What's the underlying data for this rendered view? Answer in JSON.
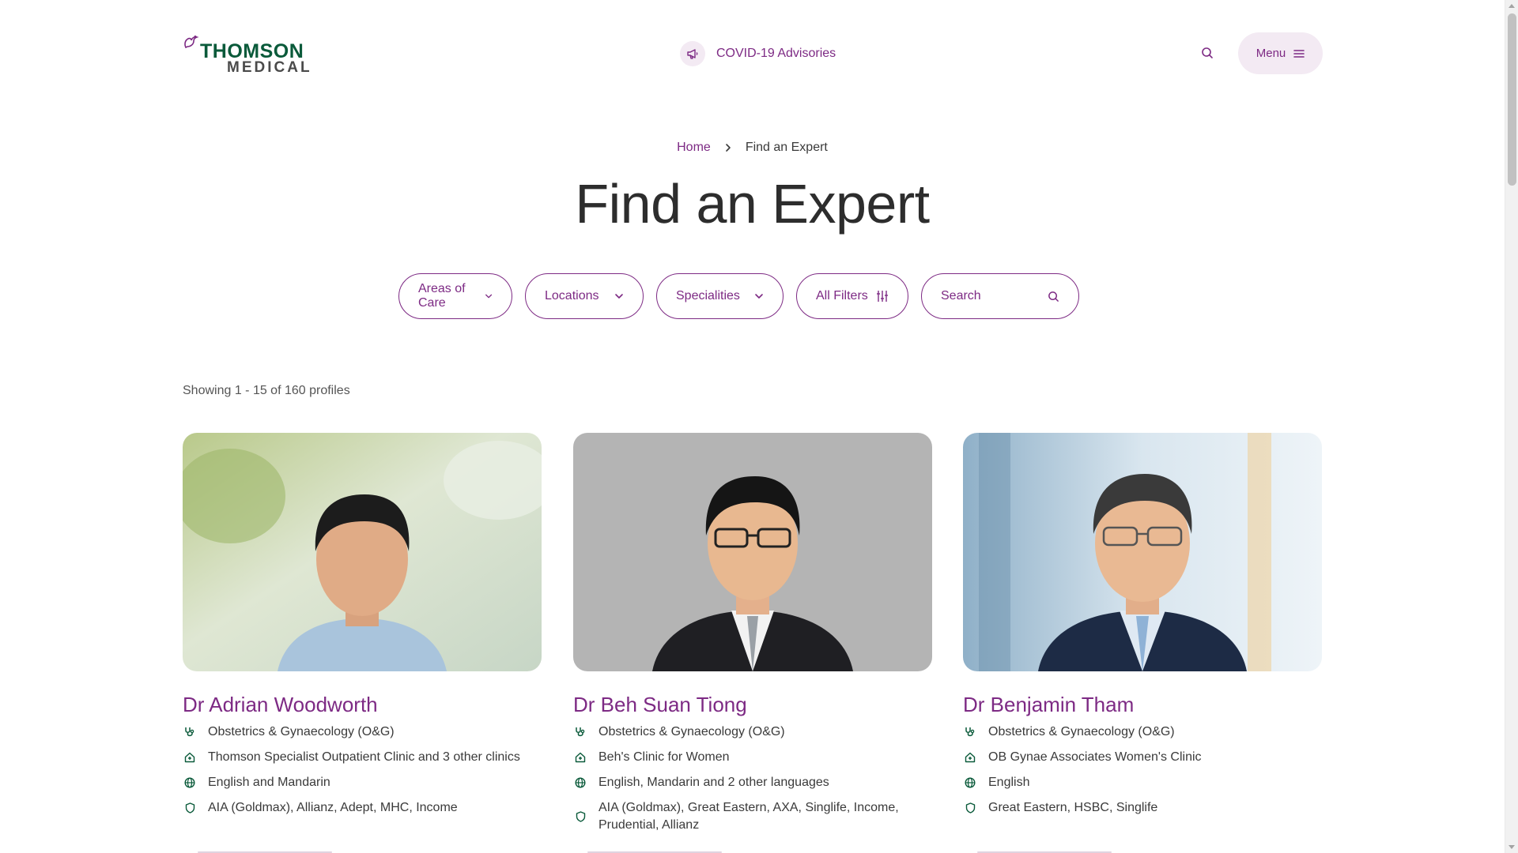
{
  "header": {
    "logo_line1": "THOMSON",
    "logo_line2": "MEDICAL",
    "advisory_label": "COVID-19 Advisories",
    "menu_label": "Menu"
  },
  "breadcrumb": {
    "home": "Home",
    "current": "Find an Expert"
  },
  "page_title": "Find an Expert",
  "filters": {
    "areas": "Areas of Care",
    "locations": "Locations",
    "specialities": "Specialities",
    "all_filters": "All Filters",
    "search_placeholder": "Search"
  },
  "showing": "Showing 1 - 15 of 160 profiles",
  "doctors": [
    {
      "name": "Dr Adrian Woodworth",
      "specialty": "Obstetrics & Gynaecology (O&G)",
      "clinic": "Thomson Specialist Outpatient Clinic and 3 other clinics",
      "languages": "English and Mandarin",
      "insurance": "AIA (Goldmax), Allianz, Adept, MHC, Income"
    },
    {
      "name": "Dr Beh Suan Tiong",
      "specialty": "Obstetrics & Gynaecology (O&G)",
      "clinic": "Beh's Clinic for Women",
      "languages": "English, Mandarin and 2 other languages",
      "insurance": "AIA (Goldmax), Great Eastern, AXA, Singlife, Income, Prudential, Allianz"
    },
    {
      "name": "Dr Benjamin Tham",
      "specialty": "Obstetrics & Gynaecology (O&G)",
      "clinic": "OB Gynae Associates Women's Clinic",
      "languages": "English",
      "insurance": "Great Eastern, HSBC, Singlife"
    }
  ],
  "colors": {
    "brand_purple": "#7d2a84",
    "brand_green": "#0a5a3a",
    "pill_bg": "#f3eaf3"
  }
}
